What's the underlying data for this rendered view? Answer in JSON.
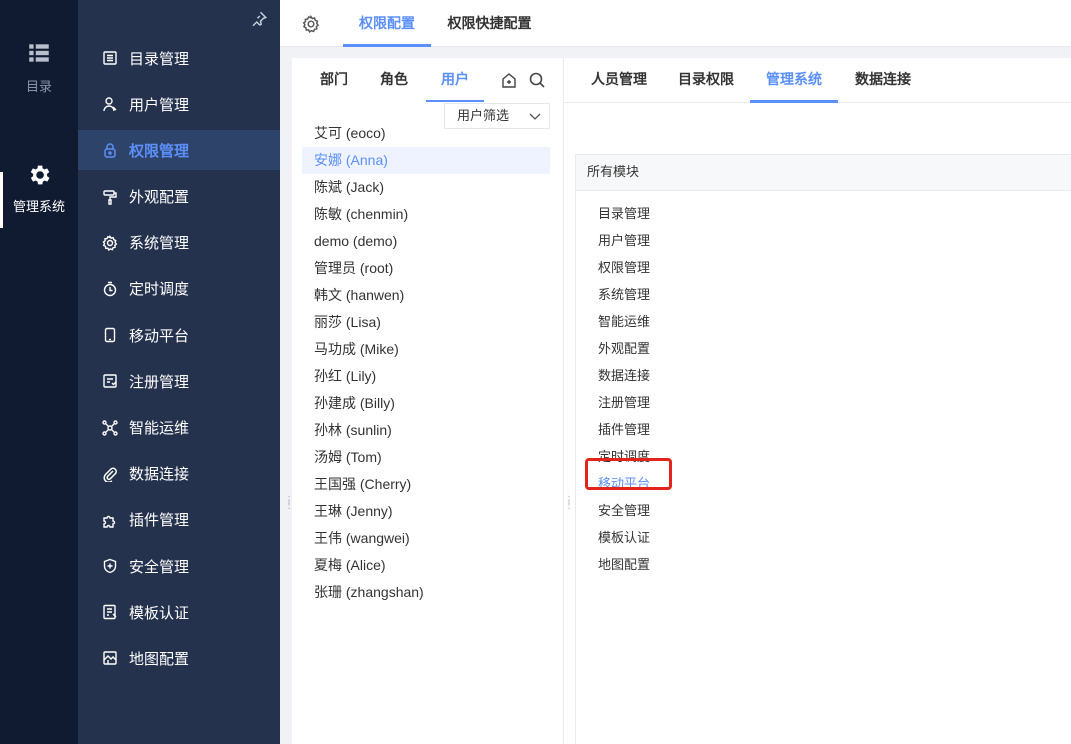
{
  "rail": {
    "items": [
      {
        "label": "目录",
        "icon": "list-icon"
      },
      {
        "label": "管理系统",
        "icon": "gear-icon"
      }
    ]
  },
  "sidebar": {
    "items": [
      {
        "label": "目录管理",
        "icon": "catalog-icon"
      },
      {
        "label": "用户管理",
        "icon": "user-icon"
      },
      {
        "label": "权限管理",
        "icon": "lock-icon",
        "active": true
      },
      {
        "label": "外观配置",
        "icon": "paint-roller-icon"
      },
      {
        "label": "系统管理",
        "icon": "gear-icon"
      },
      {
        "label": "定时调度",
        "icon": "timer-icon"
      },
      {
        "label": "移动平台",
        "icon": "mobile-icon"
      },
      {
        "label": "注册管理",
        "icon": "register-icon"
      },
      {
        "label": "智能运维",
        "icon": "network-icon"
      },
      {
        "label": "数据连接",
        "icon": "link-icon"
      },
      {
        "label": "插件管理",
        "icon": "puzzle-icon"
      },
      {
        "label": "安全管理",
        "icon": "shield-icon"
      },
      {
        "label": "模板认证",
        "icon": "template-icon"
      },
      {
        "label": "地图配置",
        "icon": "map-icon"
      }
    ]
  },
  "topbar": {
    "tabs": [
      {
        "label": "权限配置",
        "active": true
      },
      {
        "label": "权限快捷配置"
      }
    ]
  },
  "user_panel": {
    "tabs": [
      {
        "label": "部门"
      },
      {
        "label": "角色"
      },
      {
        "label": "用户",
        "active": true
      }
    ],
    "filter_label": "用户筛选",
    "users": [
      "艾可 (eoco)",
      "安娜 (Anna)",
      "陈斌 (Jack)",
      "陈敏 (chenmin)",
      "demo (demo)",
      "管理员 (root)",
      "韩文 (hanwen)",
      "丽莎 (Lisa)",
      "马功成 (Mike)",
      "孙红 (Lily)",
      "孙建成 (Billy)",
      "孙林 (sunlin)",
      "汤姆 (Tom)",
      "王国强 (Cherry)",
      "王琳 (Jenny)",
      "王伟 (wangwei)",
      "夏梅 (Alice)",
      "张珊 (zhangshan)"
    ],
    "selected_index": 1
  },
  "right_panel": {
    "tabs": [
      {
        "label": "人员管理"
      },
      {
        "label": "目录权限"
      },
      {
        "label": "管理系统",
        "active": true
      },
      {
        "label": "数据连接"
      }
    ],
    "module_header": "所有模块",
    "modules": [
      "目录管理",
      "用户管理",
      "权限管理",
      "系统管理",
      "智能运维",
      "外观配置",
      "数据连接",
      "注册管理",
      "插件管理",
      "定时调度",
      "移动平台",
      "安全管理",
      "模板认证",
      "地图配置"
    ],
    "highlighted_module_index": 10,
    "boxed_module_index": 6
  },
  "colors": {
    "rail_bg": "#101b32",
    "sidebar_bg": "#24324e",
    "accent": "#5b8ff9",
    "highlight_box": "#e1251b"
  }
}
